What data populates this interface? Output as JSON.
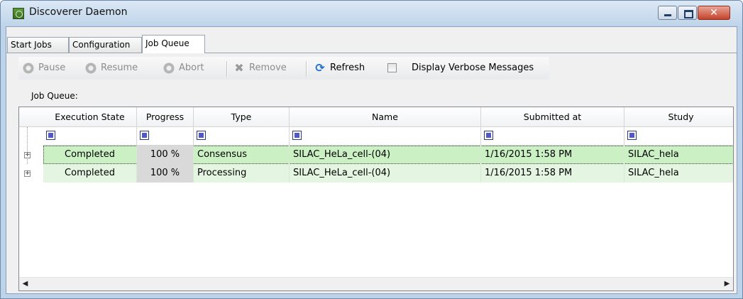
{
  "window": {
    "title": "Discoverer Daemon"
  },
  "tabs": [
    {
      "label": "Start Jobs",
      "active": false
    },
    {
      "label": "Configuration",
      "active": false
    },
    {
      "label": "Job Queue",
      "active": true
    }
  ],
  "toolbar": {
    "pause_label": "Pause",
    "resume_label": "Resume",
    "abort_label": "Abort",
    "remove_label": "Remove",
    "refresh_label": "Refresh",
    "verbose_label": "Display Verbose Messages",
    "verbose_checked": false
  },
  "queue": {
    "label": "Job Queue:",
    "columns": [
      "Execution State",
      "Progress",
      "Type",
      "Name",
      "Submitted at",
      "Study"
    ],
    "rows": [
      {
        "state": "Completed",
        "progress": "100 %",
        "type": "Consensus",
        "name": "SILAC_HeLa_cell-(04)",
        "submitted": "1/16/2015 1:58 PM",
        "study": "SILAC_hela",
        "selected": true
      },
      {
        "state": "Completed",
        "progress": "100 %",
        "type": "Processing",
        "name": "SILAC_HeLa_cell-(04)",
        "submitted": "1/16/2015 1:58 PM",
        "study": "SILAC_hela",
        "selected": false
      }
    ]
  },
  "icons": {
    "app": "discoverer-app-icon",
    "pause": "gear-icon",
    "resume": "gear-icon",
    "abort": "gear-icon",
    "remove": "x-icon",
    "refresh": "refresh-icon",
    "filter": "filter-icon",
    "expand": "plus-icon",
    "scroll_left": "arrow-left-icon",
    "scroll_right": "arrow-right-icon"
  },
  "colors": {
    "completed_row": "#caf0c4",
    "completed_row_alt": "#e4f6e1",
    "progress_cell": "#d9d9d9",
    "close_button": "#c6432c"
  }
}
